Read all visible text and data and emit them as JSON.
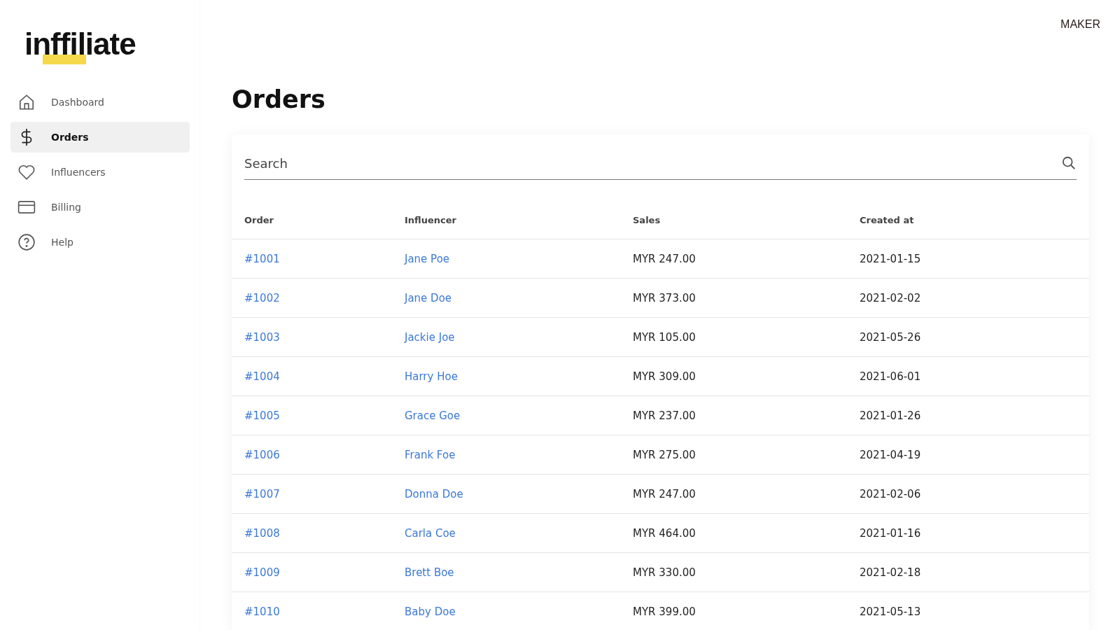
{
  "brand": {
    "logo": "inffiliate"
  },
  "sidebar": {
    "items": [
      {
        "label": "Dashboard",
        "selected": false
      },
      {
        "label": "Orders",
        "selected": true
      },
      {
        "label": "Influencers",
        "selected": false
      },
      {
        "label": "Billing",
        "selected": false
      },
      {
        "label": "Help",
        "selected": false
      }
    ]
  },
  "header": {
    "user": "MAKER"
  },
  "page": {
    "title": "Orders"
  },
  "search": {
    "placeholder": "Search"
  },
  "table": {
    "columns": [
      "Order",
      "Influencer",
      "Sales",
      "Created at"
    ],
    "rows": [
      [
        "#1001",
        "Jane Poe",
        "MYR 247.00",
        "2021-01-15"
      ],
      [
        "#1002",
        "Jane Doe",
        "MYR 373.00",
        "2021-02-02"
      ],
      [
        "#1003",
        "Jackie Joe",
        "MYR 105.00",
        "2021-05-26"
      ],
      [
        "#1004",
        "Harry Hoe",
        "MYR 309.00",
        "2021-06-01"
      ],
      [
        "#1005",
        "Grace Goe",
        "MYR 237.00",
        "2021-01-26"
      ],
      [
        "#1006",
        "Frank Foe",
        "MYR 275.00",
        "2021-04-19"
      ],
      [
        "#1007",
        "Donna Doe",
        "MYR 247.00",
        "2021-02-06"
      ],
      [
        "#1008",
        "Carla Coe",
        "MYR 464.00",
        "2021-01-16"
      ],
      [
        "#1009",
        "Brett Boe",
        "MYR 330.00",
        "2021-02-18"
      ],
      [
        "#1010",
        "Baby Doe",
        "MYR 399.00",
        "2021-05-13"
      ]
    ]
  }
}
